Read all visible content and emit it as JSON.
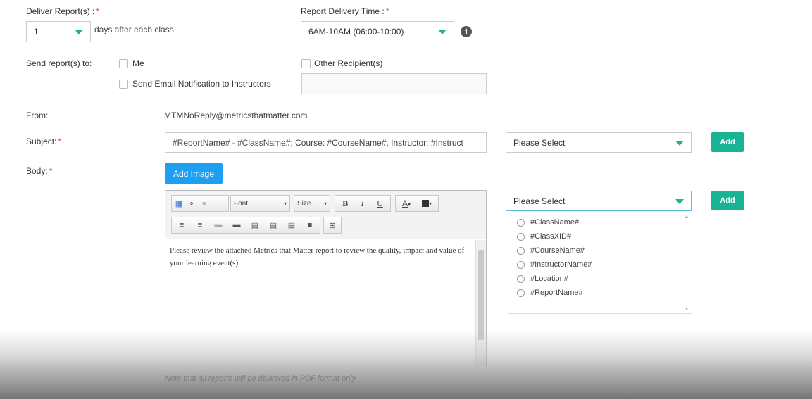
{
  "deliver": {
    "label": "Deliver Report(s) :",
    "required_mark": "*",
    "value": "1",
    "suffix": "days after each class"
  },
  "delivery_time": {
    "label": "Report Delivery Time :",
    "required_mark": "*",
    "value": "6AM-10AM (06:00-10:00)",
    "info_glyph": "i"
  },
  "send_to": {
    "label": "Send report(s) to:",
    "me": "Me",
    "instructors": "Send Email Notification to Instructors",
    "other": "Other Recipient(s)",
    "other_value": ""
  },
  "from": {
    "label": "From:",
    "value": "MTMNoReply@metricsthatmatter.com"
  },
  "subject": {
    "label": "Subject:",
    "required_mark": "*",
    "value": "#ReportName# - #ClassName#; Course: #CourseName#, Instructor: #Instruct",
    "select_value": "Please Select",
    "add_label": "Add"
  },
  "body": {
    "label": "Body:",
    "required_mark": "*",
    "add_image_label": "Add Image",
    "toolbar": {
      "font_label": "Font",
      "size_label": "Size",
      "bold": "B",
      "italic": "I",
      "underline": "U",
      "font_color": "A"
    },
    "text": "Please review the attached Metrics that Matter report to review the quality, impact and value of your learning event(s).",
    "select_value": "Please Select",
    "add_label": "Add",
    "options": [
      "#ClassName#",
      "#ClassXID#",
      "#CourseName#",
      "#InstructorName#",
      "#Location#",
      "#ReportName#"
    ],
    "note": "Note that all reports will be delivered in PDF format only."
  },
  "colors": {
    "accent": "#1ab394",
    "blue": "#1e9ff2",
    "required": "#e74c3c"
  }
}
